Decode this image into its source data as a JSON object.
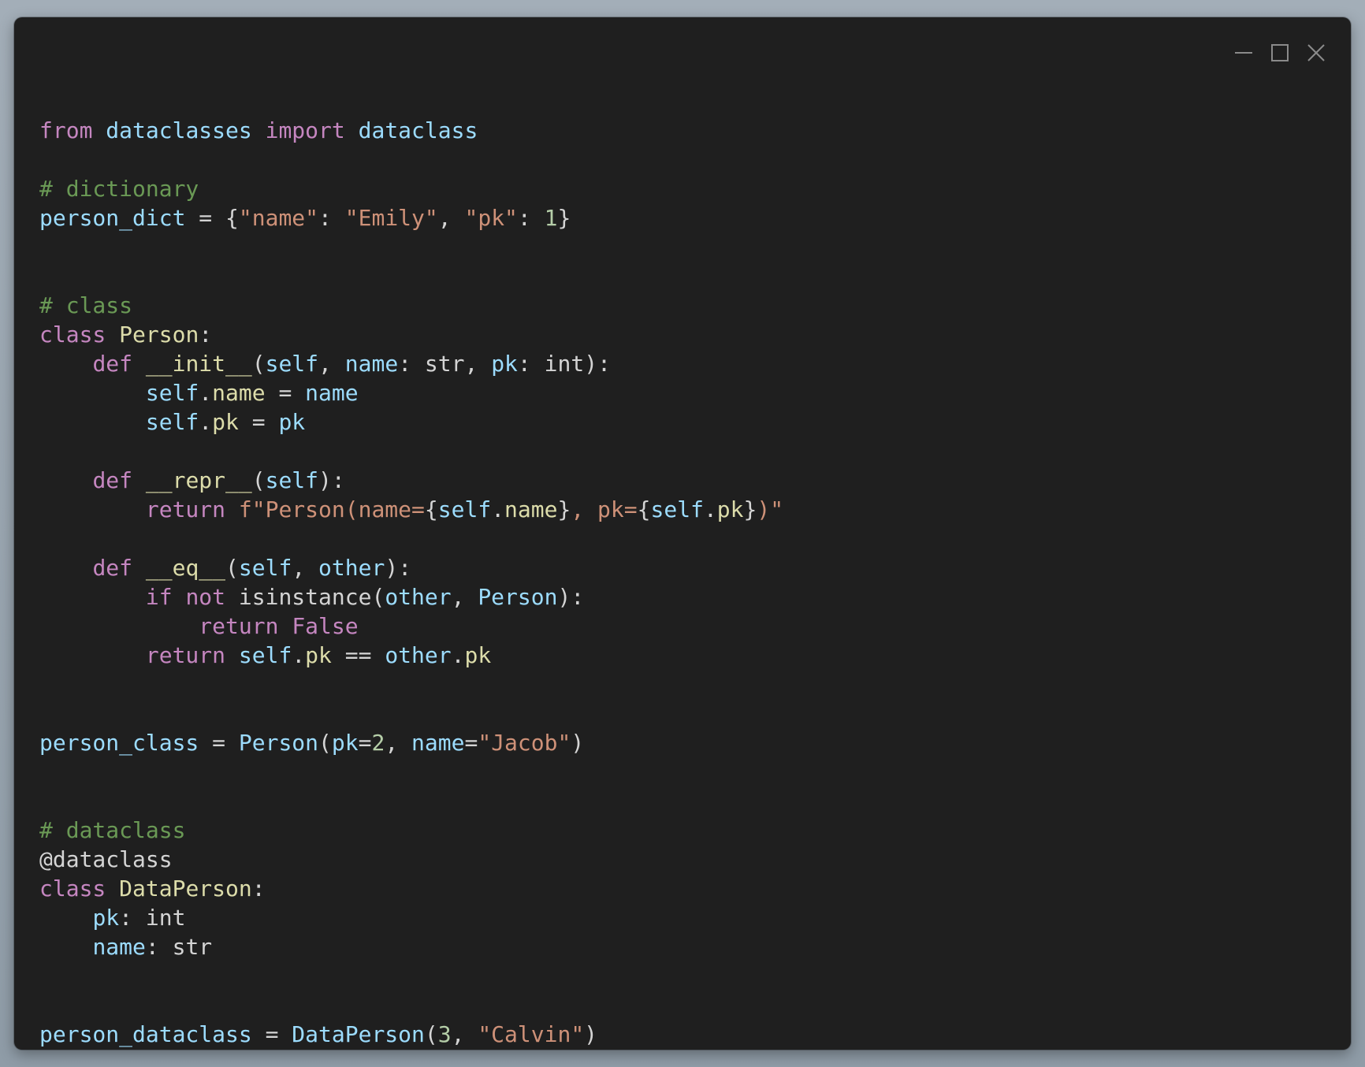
{
  "window": {
    "controls": {
      "minimize": "minimize-icon",
      "maximize": "maximize-icon",
      "close": "close-icon"
    }
  },
  "code": {
    "lines": [
      [
        [
          "kw",
          "from"
        ],
        [
          "op",
          " "
        ],
        [
          "id",
          "dataclasses"
        ],
        [
          "op",
          " "
        ],
        [
          "kw",
          "import"
        ],
        [
          "op",
          " "
        ],
        [
          "id",
          "dataclass"
        ]
      ],
      [],
      [
        [
          "cm",
          "# dictionary"
        ]
      ],
      [
        [
          "id",
          "person_dict"
        ],
        [
          "op",
          " = {"
        ],
        [
          "str",
          "\"name\""
        ],
        [
          "op",
          ": "
        ],
        [
          "str",
          "\"Emily\""
        ],
        [
          "op",
          ", "
        ],
        [
          "str",
          "\"pk\""
        ],
        [
          "op",
          ": "
        ],
        [
          "num",
          "1"
        ],
        [
          "op",
          "}"
        ]
      ],
      [],
      [],
      [
        [
          "cm",
          "# class"
        ]
      ],
      [
        [
          "kw",
          "class"
        ],
        [
          "op",
          " "
        ],
        [
          "cls",
          "Person"
        ],
        [
          "op",
          ":"
        ]
      ],
      [
        [
          "op",
          "    "
        ],
        [
          "kw",
          "def"
        ],
        [
          "op",
          " "
        ],
        [
          "fn",
          "__init__"
        ],
        [
          "op",
          "("
        ],
        [
          "id",
          "self"
        ],
        [
          "op",
          ", "
        ],
        [
          "id",
          "name"
        ],
        [
          "op",
          ": "
        ],
        [
          "typ",
          "str"
        ],
        [
          "op",
          ", "
        ],
        [
          "id",
          "pk"
        ],
        [
          "op",
          ": "
        ],
        [
          "typ",
          "int"
        ],
        [
          "op",
          "):"
        ]
      ],
      [
        [
          "op",
          "        "
        ],
        [
          "id",
          "self"
        ],
        [
          "op",
          "."
        ],
        [
          "fn",
          "name"
        ],
        [
          "op",
          " = "
        ],
        [
          "id",
          "name"
        ]
      ],
      [
        [
          "op",
          "        "
        ],
        [
          "id",
          "self"
        ],
        [
          "op",
          "."
        ],
        [
          "fn",
          "pk"
        ],
        [
          "op",
          " = "
        ],
        [
          "id",
          "pk"
        ]
      ],
      [],
      [
        [
          "op",
          "    "
        ],
        [
          "kw",
          "def"
        ],
        [
          "op",
          " "
        ],
        [
          "fn",
          "__repr__"
        ],
        [
          "op",
          "("
        ],
        [
          "id",
          "self"
        ],
        [
          "op",
          "):"
        ]
      ],
      [
        [
          "op",
          "        "
        ],
        [
          "kw",
          "return"
        ],
        [
          "op",
          " "
        ],
        [
          "str",
          "f\"Person(name="
        ],
        [
          "op",
          "{"
        ],
        [
          "id",
          "self"
        ],
        [
          "op",
          "."
        ],
        [
          "fn",
          "name"
        ],
        [
          "op",
          "}"
        ],
        [
          "str",
          ", pk="
        ],
        [
          "op",
          "{"
        ],
        [
          "id",
          "self"
        ],
        [
          "op",
          "."
        ],
        [
          "fn",
          "pk"
        ],
        [
          "op",
          "}"
        ],
        [
          "str",
          ")\""
        ]
      ],
      [],
      [
        [
          "op",
          "    "
        ],
        [
          "kw",
          "def"
        ],
        [
          "op",
          " "
        ],
        [
          "fn",
          "__eq__"
        ],
        [
          "op",
          "("
        ],
        [
          "id",
          "self"
        ],
        [
          "op",
          ", "
        ],
        [
          "id",
          "other"
        ],
        [
          "op",
          "):"
        ]
      ],
      [
        [
          "op",
          "        "
        ],
        [
          "kw",
          "if"
        ],
        [
          "op",
          " "
        ],
        [
          "kw",
          "not"
        ],
        [
          "op",
          " "
        ],
        [
          "typ",
          "isinstance"
        ],
        [
          "op",
          "("
        ],
        [
          "id",
          "other"
        ],
        [
          "op",
          ", "
        ],
        [
          "id",
          "Person"
        ],
        [
          "op",
          "):"
        ]
      ],
      [
        [
          "op",
          "            "
        ],
        [
          "kw",
          "return"
        ],
        [
          "op",
          " "
        ],
        [
          "kw",
          "False"
        ]
      ],
      [
        [
          "op",
          "        "
        ],
        [
          "kw",
          "return"
        ],
        [
          "op",
          " "
        ],
        [
          "id",
          "self"
        ],
        [
          "op",
          "."
        ],
        [
          "fn",
          "pk"
        ],
        [
          "op",
          " == "
        ],
        [
          "id",
          "other"
        ],
        [
          "op",
          "."
        ],
        [
          "fn",
          "pk"
        ]
      ],
      [],
      [],
      [
        [
          "id",
          "person_class"
        ],
        [
          "op",
          " = "
        ],
        [
          "id",
          "Person"
        ],
        [
          "op",
          "("
        ],
        [
          "id",
          "pk"
        ],
        [
          "op",
          "="
        ],
        [
          "num",
          "2"
        ],
        [
          "op",
          ", "
        ],
        [
          "id",
          "name"
        ],
        [
          "op",
          "="
        ],
        [
          "str",
          "\"Jacob\""
        ],
        [
          "op",
          ")"
        ]
      ],
      [],
      [],
      [
        [
          "cm",
          "# dataclass"
        ]
      ],
      [
        [
          "op",
          "@dataclass"
        ]
      ],
      [
        [
          "kw",
          "class"
        ],
        [
          "op",
          " "
        ],
        [
          "cls",
          "DataPerson"
        ],
        [
          "op",
          ":"
        ]
      ],
      [
        [
          "op",
          "    "
        ],
        [
          "id",
          "pk"
        ],
        [
          "op",
          ": "
        ],
        [
          "typ",
          "int"
        ]
      ],
      [
        [
          "op",
          "    "
        ],
        [
          "id",
          "name"
        ],
        [
          "op",
          ": "
        ],
        [
          "typ",
          "str"
        ]
      ],
      [],
      [],
      [
        [
          "id",
          "person_dataclass"
        ],
        [
          "op",
          " = "
        ],
        [
          "id",
          "DataPerson"
        ],
        [
          "op",
          "("
        ],
        [
          "num",
          "3"
        ],
        [
          "op",
          ", "
        ],
        [
          "str",
          "\"Calvin\""
        ],
        [
          "op",
          ")"
        ]
      ]
    ]
  }
}
